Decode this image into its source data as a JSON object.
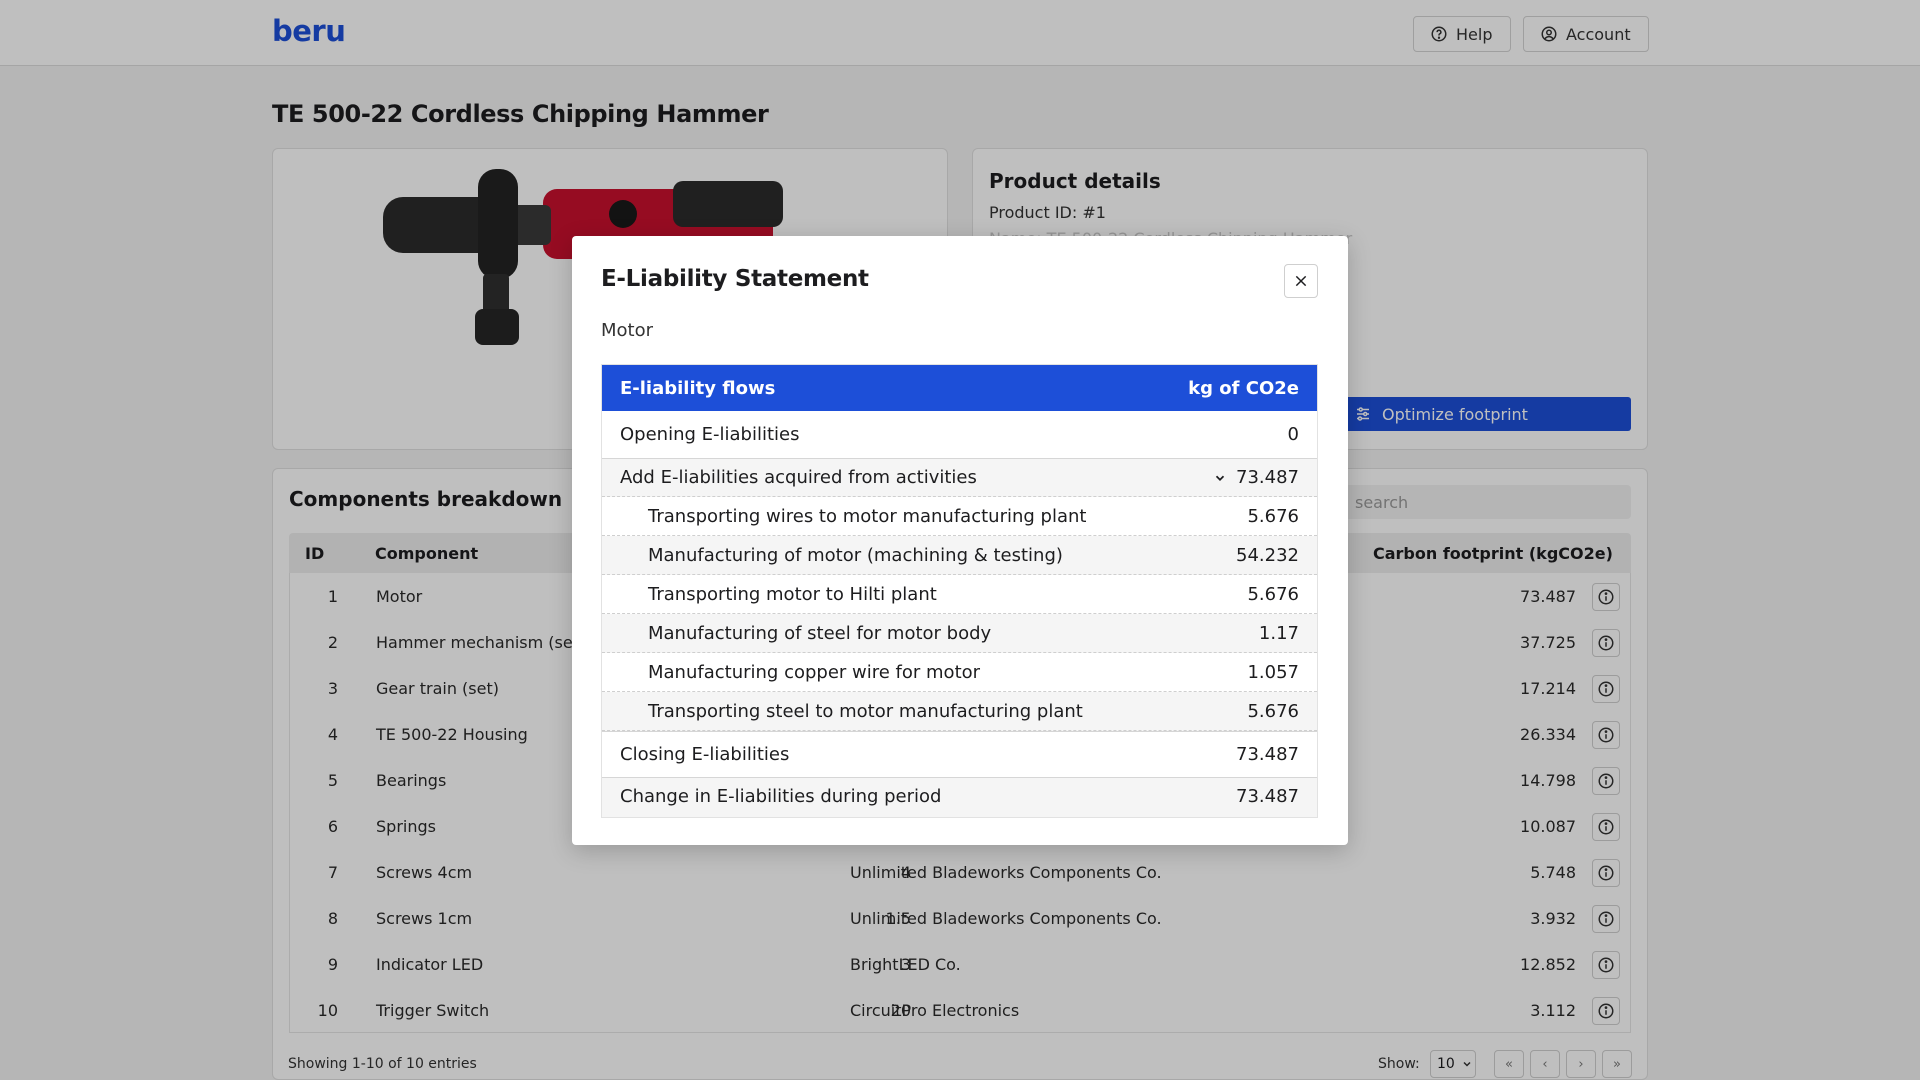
{
  "header": {
    "logo": "beru",
    "help_label": "Help",
    "account_label": "Account"
  },
  "page": {
    "title": "TE 500-22 Cordless Chipping Hammer"
  },
  "product_details": {
    "title": "Product details",
    "product_id": "Product ID: #1",
    "name_line": "Name: TE 500-22 Cordless Chipping Hammer",
    "optimize_label": "Optimize footprint"
  },
  "components": {
    "title": "Components breakdown",
    "search_placeholder": "search",
    "columns": {
      "id": "ID",
      "component": "Component",
      "footprint": "Carbon footprint (kgCO2e)"
    },
    "rows": [
      {
        "id": "1",
        "name": "Motor",
        "qty": "",
        "supplier": "",
        "footprint": "73.487"
      },
      {
        "id": "2",
        "name": "Hammer mechanism (set)",
        "qty": "",
        "supplier": "",
        "footprint": "37.725"
      },
      {
        "id": "3",
        "name": "Gear train (set)",
        "qty": "",
        "supplier": "",
        "footprint": "17.214"
      },
      {
        "id": "4",
        "name": "TE 500-22 Housing",
        "qty": "",
        "supplier": "",
        "footprint": "26.334"
      },
      {
        "id": "5",
        "name": "Bearings",
        "qty": "",
        "supplier": "",
        "footprint": "14.798"
      },
      {
        "id": "6",
        "name": "Springs",
        "qty": "",
        "supplier": "",
        "footprint": "10.087"
      },
      {
        "id": "7",
        "name": "Screws 4cm",
        "qty": "4",
        "supplier": "Unlimited Bladeworks Components Co.",
        "footprint": "5.748"
      },
      {
        "id": "8",
        "name": "Screws 1cm",
        "qty": "1.5",
        "supplier": "Unlimited Bladeworks Components Co.",
        "footprint": "3.932"
      },
      {
        "id": "9",
        "name": "Indicator LED",
        "qty": "3",
        "supplier": "BrightLED Co.",
        "footprint": "12.852"
      },
      {
        "id": "10",
        "name": "Trigger Switch",
        "qty": "20",
        "supplier": "CircuitPro Electronics",
        "footprint": "3.112"
      }
    ],
    "footer": "Showing 1-10 of 10 entries",
    "show_label": "Show:",
    "page_size": "10"
  },
  "modal": {
    "title": "E-Liability Statement",
    "subtitle": "Motor",
    "header_left": "E-liability flows",
    "header_right": "kg of CO2e",
    "opening_label": "Opening E-liabilities",
    "opening_value": "0",
    "acquired_label": "Add E-liabilities acquired from activities",
    "acquired_value": "73.487",
    "activities": [
      {
        "label": "Transporting wires to motor manufacturing plant",
        "value": "5.676"
      },
      {
        "label": "Manufacturing of motor (machining & testing)",
        "value": "54.232"
      },
      {
        "label": "Transporting motor to Hilti plant",
        "value": "5.676"
      },
      {
        "label": "Manufacturing of steel for motor body",
        "value": "1.17"
      },
      {
        "label": "Manufacturing copper wire for motor",
        "value": "1.057"
      },
      {
        "label": "Transporting steel to motor manufacturing plant",
        "value": "5.676"
      }
    ],
    "closing_label": "Closing E-liabilities",
    "closing_value": "73.487",
    "change_label": "Change in E-liabilities during period",
    "change_value": "73.487"
  }
}
